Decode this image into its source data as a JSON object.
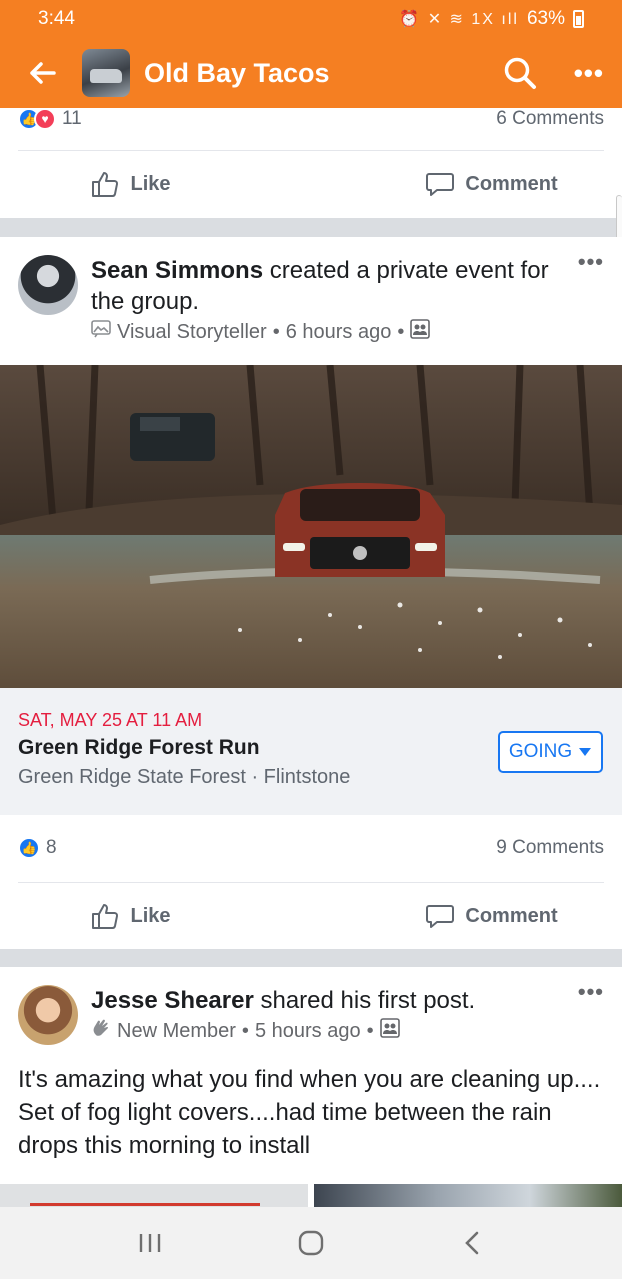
{
  "status_bar": {
    "time": "3:44",
    "icons": "⏰ ✕ ≋ 1X ıll",
    "battery": "63%"
  },
  "app_bar": {
    "title": "Old Bay Tacos"
  },
  "colors": {
    "brand_orange": "#f57f22",
    "link_blue": "#1877f2",
    "event_red": "#e41e3f"
  },
  "prev_post": {
    "reaction_count": "11",
    "comments": "6 Comments",
    "like_label": "Like",
    "comment_label": "Comment"
  },
  "event_post": {
    "author": "Sean Simmons",
    "action_text": " created a private event for the group.",
    "badge": "Visual Storyteller",
    "time": "6 hours ago",
    "event": {
      "date": "SAT, MAY 25 AT 11 AM",
      "title": "Green Ridge Forest Run",
      "place": "Green Ridge State Forest · Flintstone",
      "rsvp": "GOING"
    },
    "reaction_count": "8",
    "comments": "9 Comments",
    "like_label": "Like",
    "comment_label": "Comment"
  },
  "member_post": {
    "author": "Jesse Shearer",
    "action_text": " shared his first post.",
    "badge": "New Member",
    "time": "5 hours ago",
    "body": "It's amazing what you find when you are cleaning up.... Set of fog light covers....had time between the rain drops this morning to install"
  }
}
